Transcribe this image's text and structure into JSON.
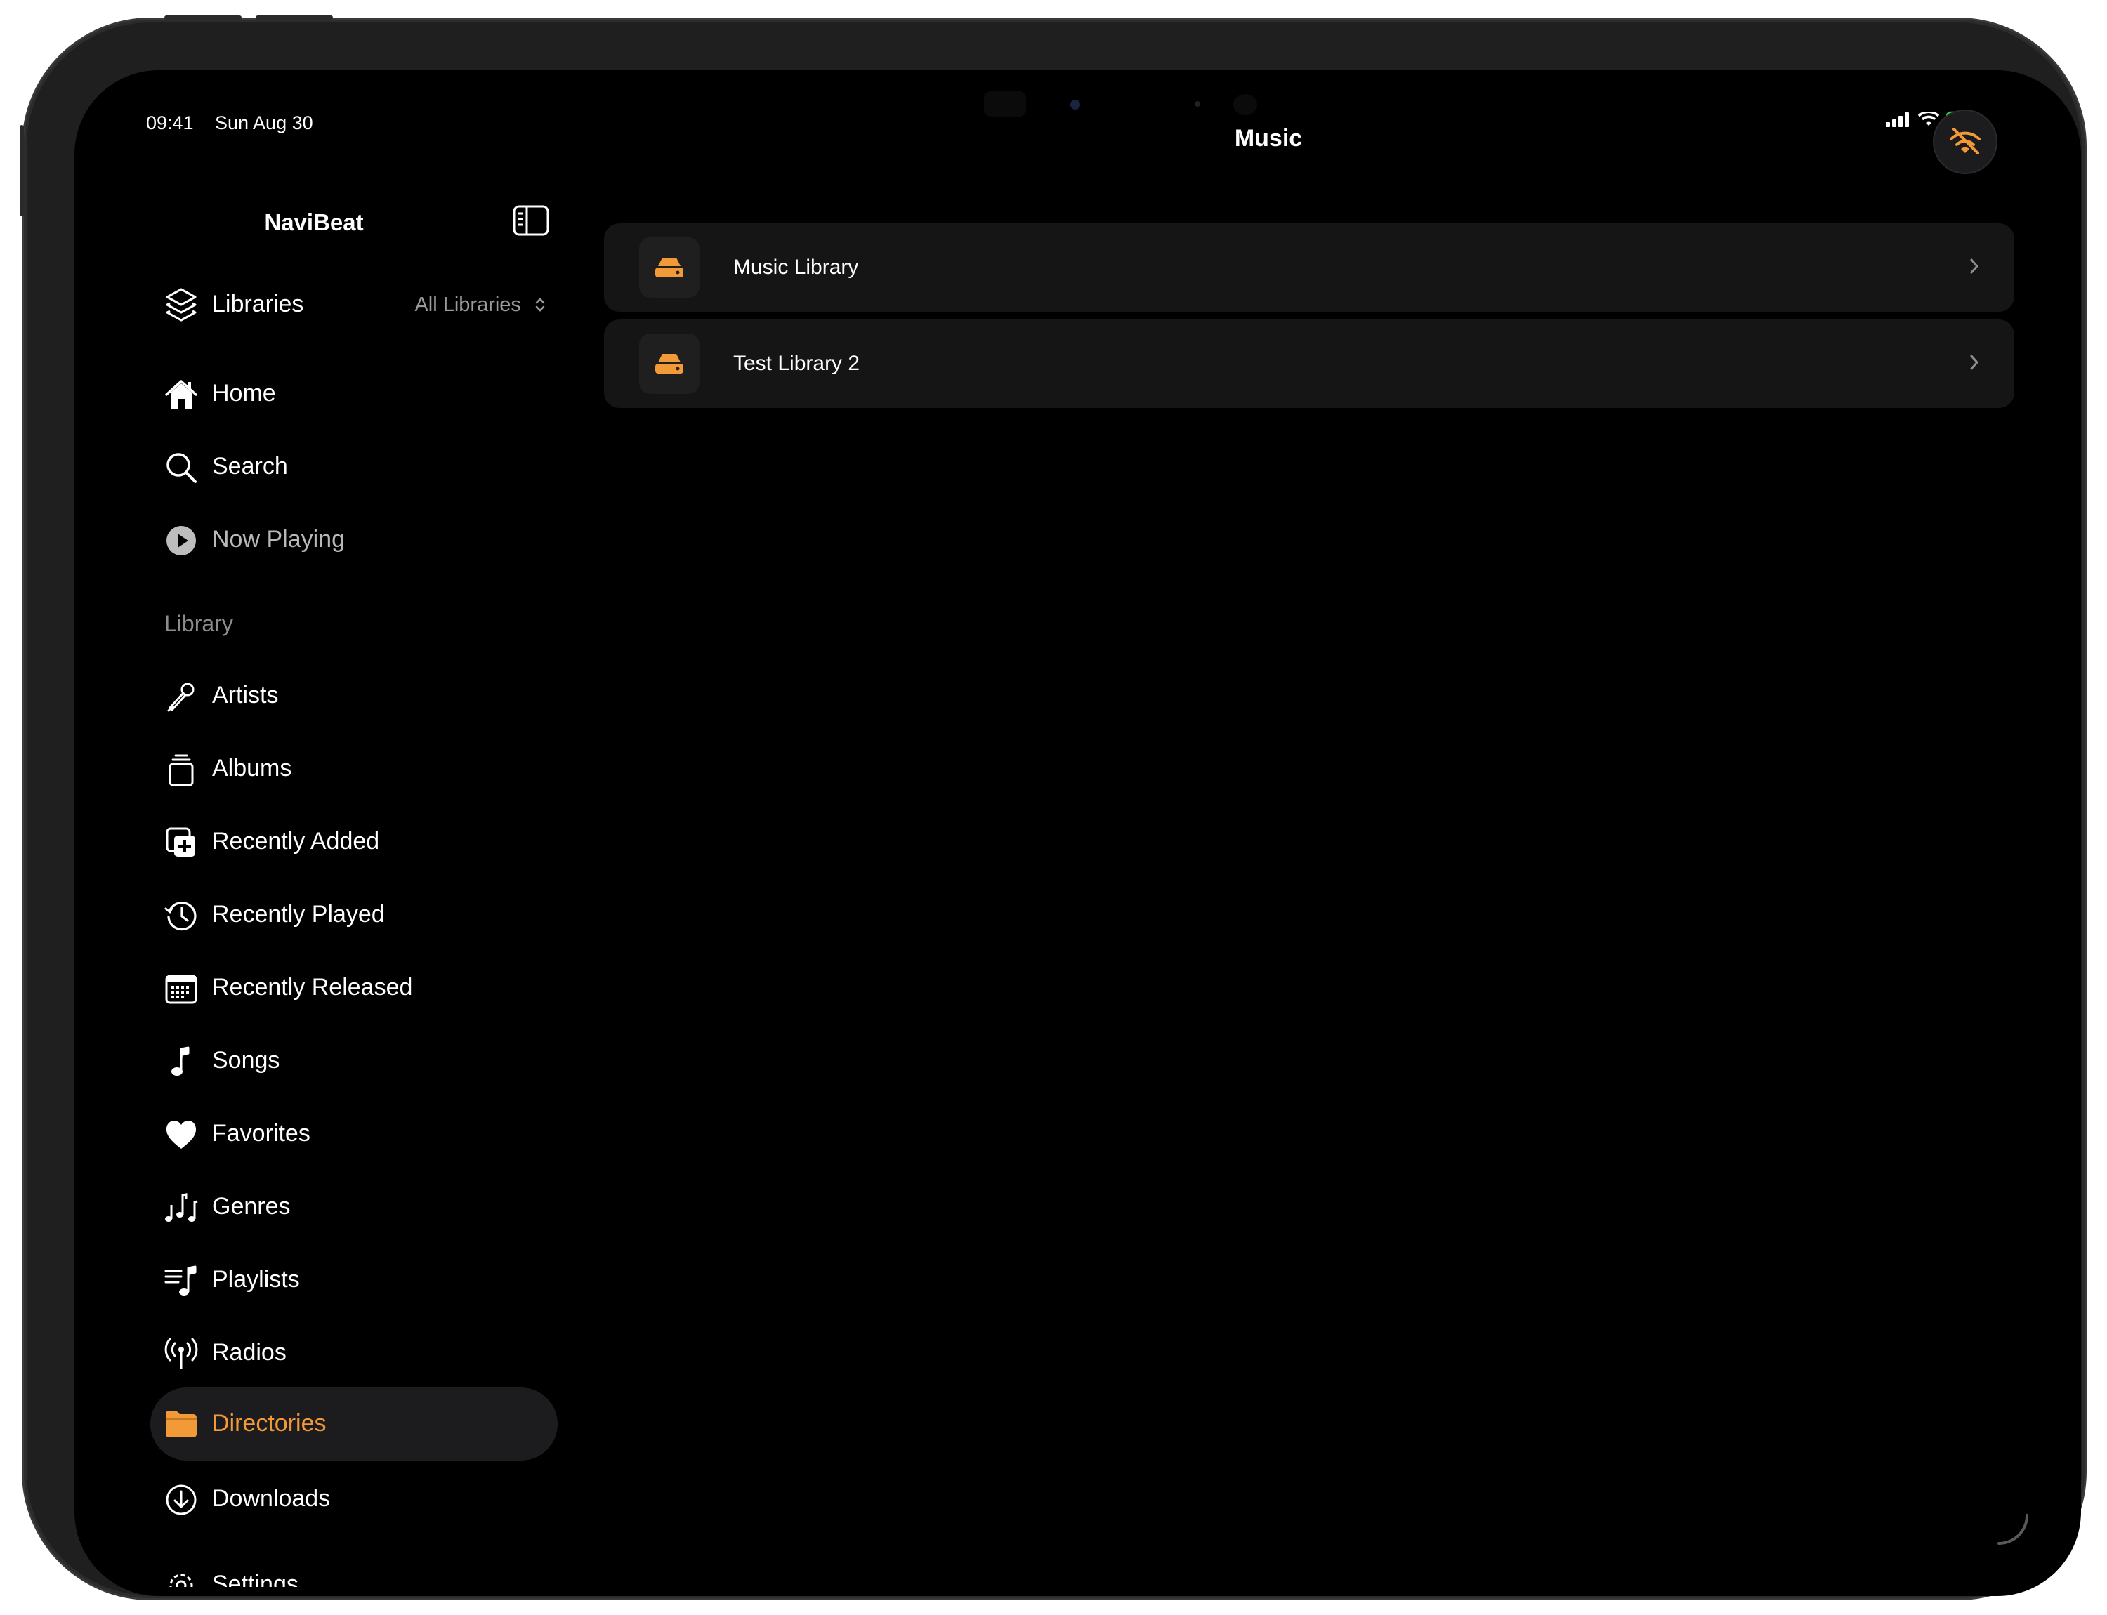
{
  "status_bar": {
    "time": "09:41",
    "date": "Sun Aug 30",
    "battery_color": "#34c759"
  },
  "sidebar": {
    "title": "NaviBeat",
    "libraries": {
      "label": "Libraries",
      "selected": "All Libraries"
    },
    "top_items": [
      {
        "label": "Home",
        "icon": "house-icon"
      },
      {
        "label": "Search",
        "icon": "magnifyingglass-icon"
      },
      {
        "label": "Now Playing",
        "icon": "play-circle-icon"
      }
    ],
    "section_label": "Library",
    "library_items": [
      {
        "label": "Artists",
        "icon": "microphone-icon"
      },
      {
        "label": "Albums",
        "icon": "album-stack-icon"
      },
      {
        "label": "Recently Added",
        "icon": "photo-plus-icon"
      },
      {
        "label": "Recently Played",
        "icon": "clock-history-icon"
      },
      {
        "label": "Recently Released",
        "icon": "calendar-icon"
      },
      {
        "label": "Songs",
        "icon": "music-note-icon"
      },
      {
        "label": "Favorites",
        "icon": "heart-icon"
      },
      {
        "label": "Genres",
        "icon": "music-notes-icon"
      },
      {
        "label": "Playlists",
        "icon": "music-list-icon"
      },
      {
        "label": "Radios",
        "icon": "antenna-icon"
      },
      {
        "label": "Directories",
        "icon": "folder-icon",
        "active": true
      },
      {
        "label": "Downloads",
        "icon": "arrow-down-circle-icon"
      },
      {
        "label": "Settings",
        "icon": "gear-icon"
      }
    ]
  },
  "main": {
    "title": "Music",
    "libraries": [
      {
        "name": "Music Library",
        "icon": "server-drive-icon"
      },
      {
        "name": "Test Library 2",
        "icon": "server-drive-icon"
      }
    ]
  },
  "colors": {
    "accent": "#f29a38",
    "row_background": "#151515",
    "active_background": "#1c1c1e"
  }
}
